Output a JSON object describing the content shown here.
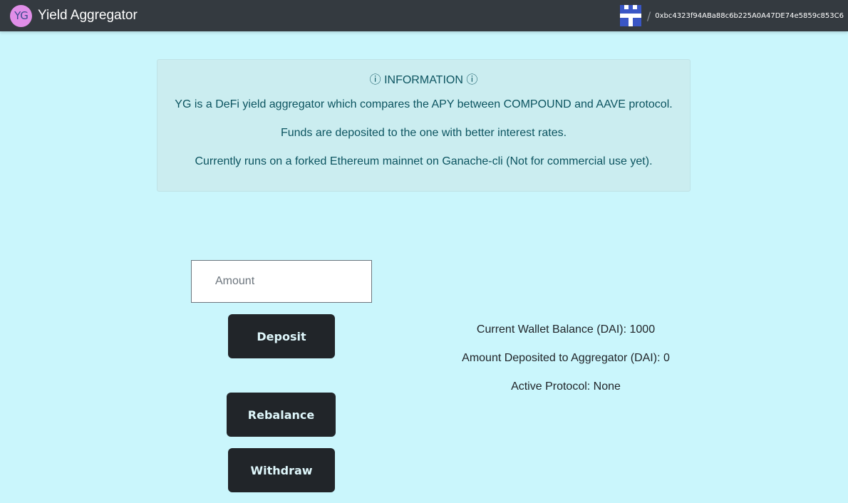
{
  "header": {
    "logo_text": "YG",
    "app_title": "Yield Aggregator",
    "separator": "/",
    "wallet_address": "0xbc4323f94ABa88c6b225A0A47DE74e5859c853C6"
  },
  "info": {
    "title": "ⓘ INFORMATION ⓘ",
    "line1": "YG is a DeFi yield aggregator which compares the APY between COMPOUND and AAVE protocol.",
    "line2": "Funds are deposited to the one with better interest rates.",
    "line3": "Currently runs on a forked Ethereum mainnet on Ganache-cli (Not for commercial use yet)."
  },
  "form": {
    "amount_placeholder": "Amount",
    "amount_value": "",
    "deposit_label": "Deposit",
    "rebalance_label": "Rebalance",
    "withdraw_label": "Withdraw"
  },
  "stats": {
    "wallet_balance": "Current Wallet Balance (DAI): 1000",
    "deposited": "Amount Deposited to Aggregator (DAI): 0",
    "active_protocol": "Active Protocol: None"
  },
  "colors": {
    "page_bg": "#caf6fc",
    "navbar_bg": "#343a40",
    "info_bg": "#cbedf0",
    "info_text": "#0c5460",
    "button_bg": "#212529",
    "identicon_fill": "#3a56c5"
  },
  "icons": {
    "logo": "yg-logo-icon",
    "avatar": "identicon-avatar-icon"
  }
}
